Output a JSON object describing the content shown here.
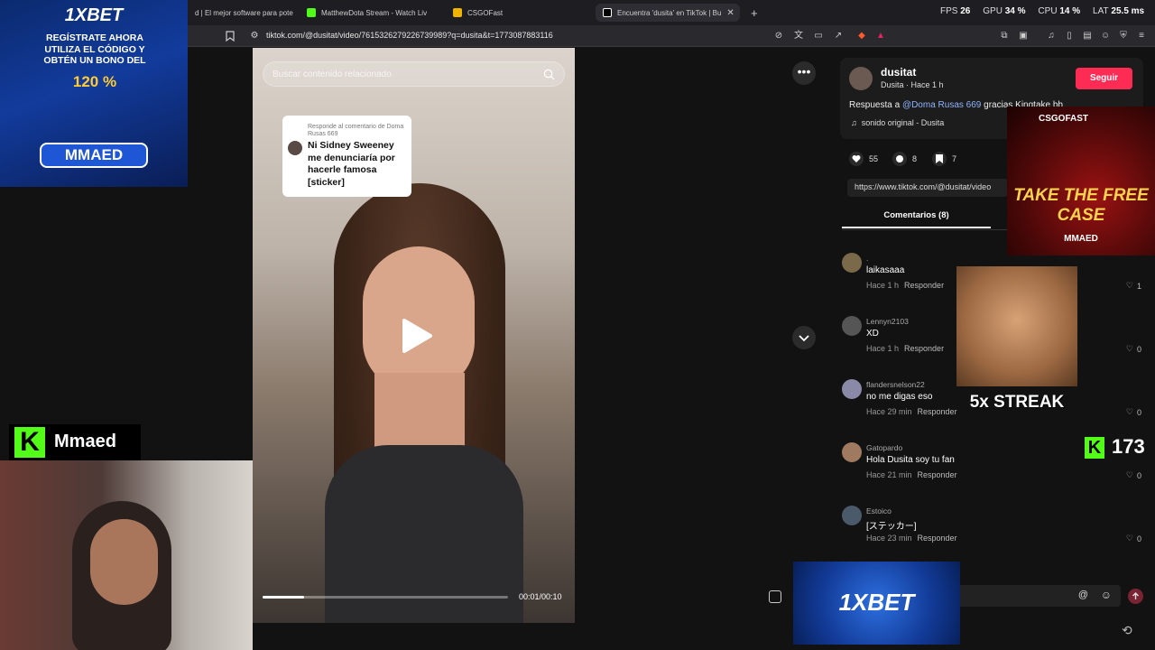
{
  "browser": {
    "tabs": [
      {
        "label": "d | El mejor software para pote",
        "active": false,
        "color": "#8a8a8a"
      },
      {
        "label": "MatthewDota Stream - Watch Liv",
        "active": false,
        "color": "#53fc18"
      },
      {
        "label": "CSGOFast",
        "active": false,
        "color": "#f0b400"
      },
      {
        "label": "Encuentra 'dusita' en TikTok | Bu",
        "active": true,
        "color": "#ffffff"
      }
    ],
    "new_tab": "+",
    "url": "tiktok.com/@dusitat/video/7615326279226739989?q=dusita&t=1773087883116"
  },
  "overlay_stats": {
    "fps_label": "FPS",
    "fps": "26",
    "gpu_label": "GPU",
    "gpu": "34 %",
    "cpu_label": "CPU",
    "cpu": "14 %",
    "lat_label": "LAT",
    "lat": "25.5 ms"
  },
  "video": {
    "search_placeholder": "Buscar contenido relacionado",
    "sticker_reply": "Responde al comentario de Doma Rusas 669",
    "sticker_text": "Ni Sidney Sweeney me denunciaría por hacerle famosa [sticker]",
    "progress": 0.17,
    "time": "00:01/00:10"
  },
  "author": {
    "name": "dusitat",
    "sub": "Dusita · Hace 1 h",
    "follow": "Seguir",
    "desc_prefix": "Respuesta a ",
    "desc_mention": "@Doma Rusas 669",
    "desc_rest": " gracias Kingtake bb",
    "sound": "sonido original - Dusita"
  },
  "stats": {
    "likes": "55",
    "comments": "8",
    "saves": "7"
  },
  "link": "https://www.tiktok.com/@dusitat/video",
  "comments_tab": "Comentarios (8)",
  "comments": [
    {
      "name": ".",
      "text": "laikasaaa",
      "time": "Hace 1 h",
      "reply": "Responder",
      "likes": "1",
      "avatar": "#7a6a4a"
    },
    {
      "name": "Lennyn2103",
      "text": "XD",
      "time": "Hace 1 h",
      "reply": "Responder",
      "likes": "0",
      "avatar": "#555"
    },
    {
      "name": "flandersnelson22",
      "text": "no me digas eso",
      "time": "Hace 29 min",
      "reply": "Responder",
      "likes": "0",
      "avatar": "#8a8aa8"
    },
    {
      "name": "Gatopardo",
      "text": "Hola Dusita soy tu fan",
      "time": "Hace 21 min",
      "reply": "Responder",
      "likes": "0",
      "avatar": "#a07a60"
    },
    {
      "name": "Estoico",
      "text": "[ステッカー]",
      "time": "Hace 23 min",
      "reply": "Responder",
      "likes": "0",
      "avatar": "#4a5a6a"
    }
  ],
  "ads": {
    "xbet_logo": "1XBET",
    "xbet_text": "REGÍSTRATE AHORA UTILIZA EL CÓDIGO Y OBTÉN UN BONO DEL",
    "xbet_bonus": "120 %",
    "xbet_code": "MMAED",
    "bottom_logo": "1XBET"
  },
  "stream": {
    "kick_name": "Mmaed",
    "csgo_title": "CSGOFAST",
    "csgo_case": "TAKE THE FREE CASE",
    "csgo_brand": "MMAED",
    "streak": "5x STREAK",
    "kick_count": "173"
  }
}
